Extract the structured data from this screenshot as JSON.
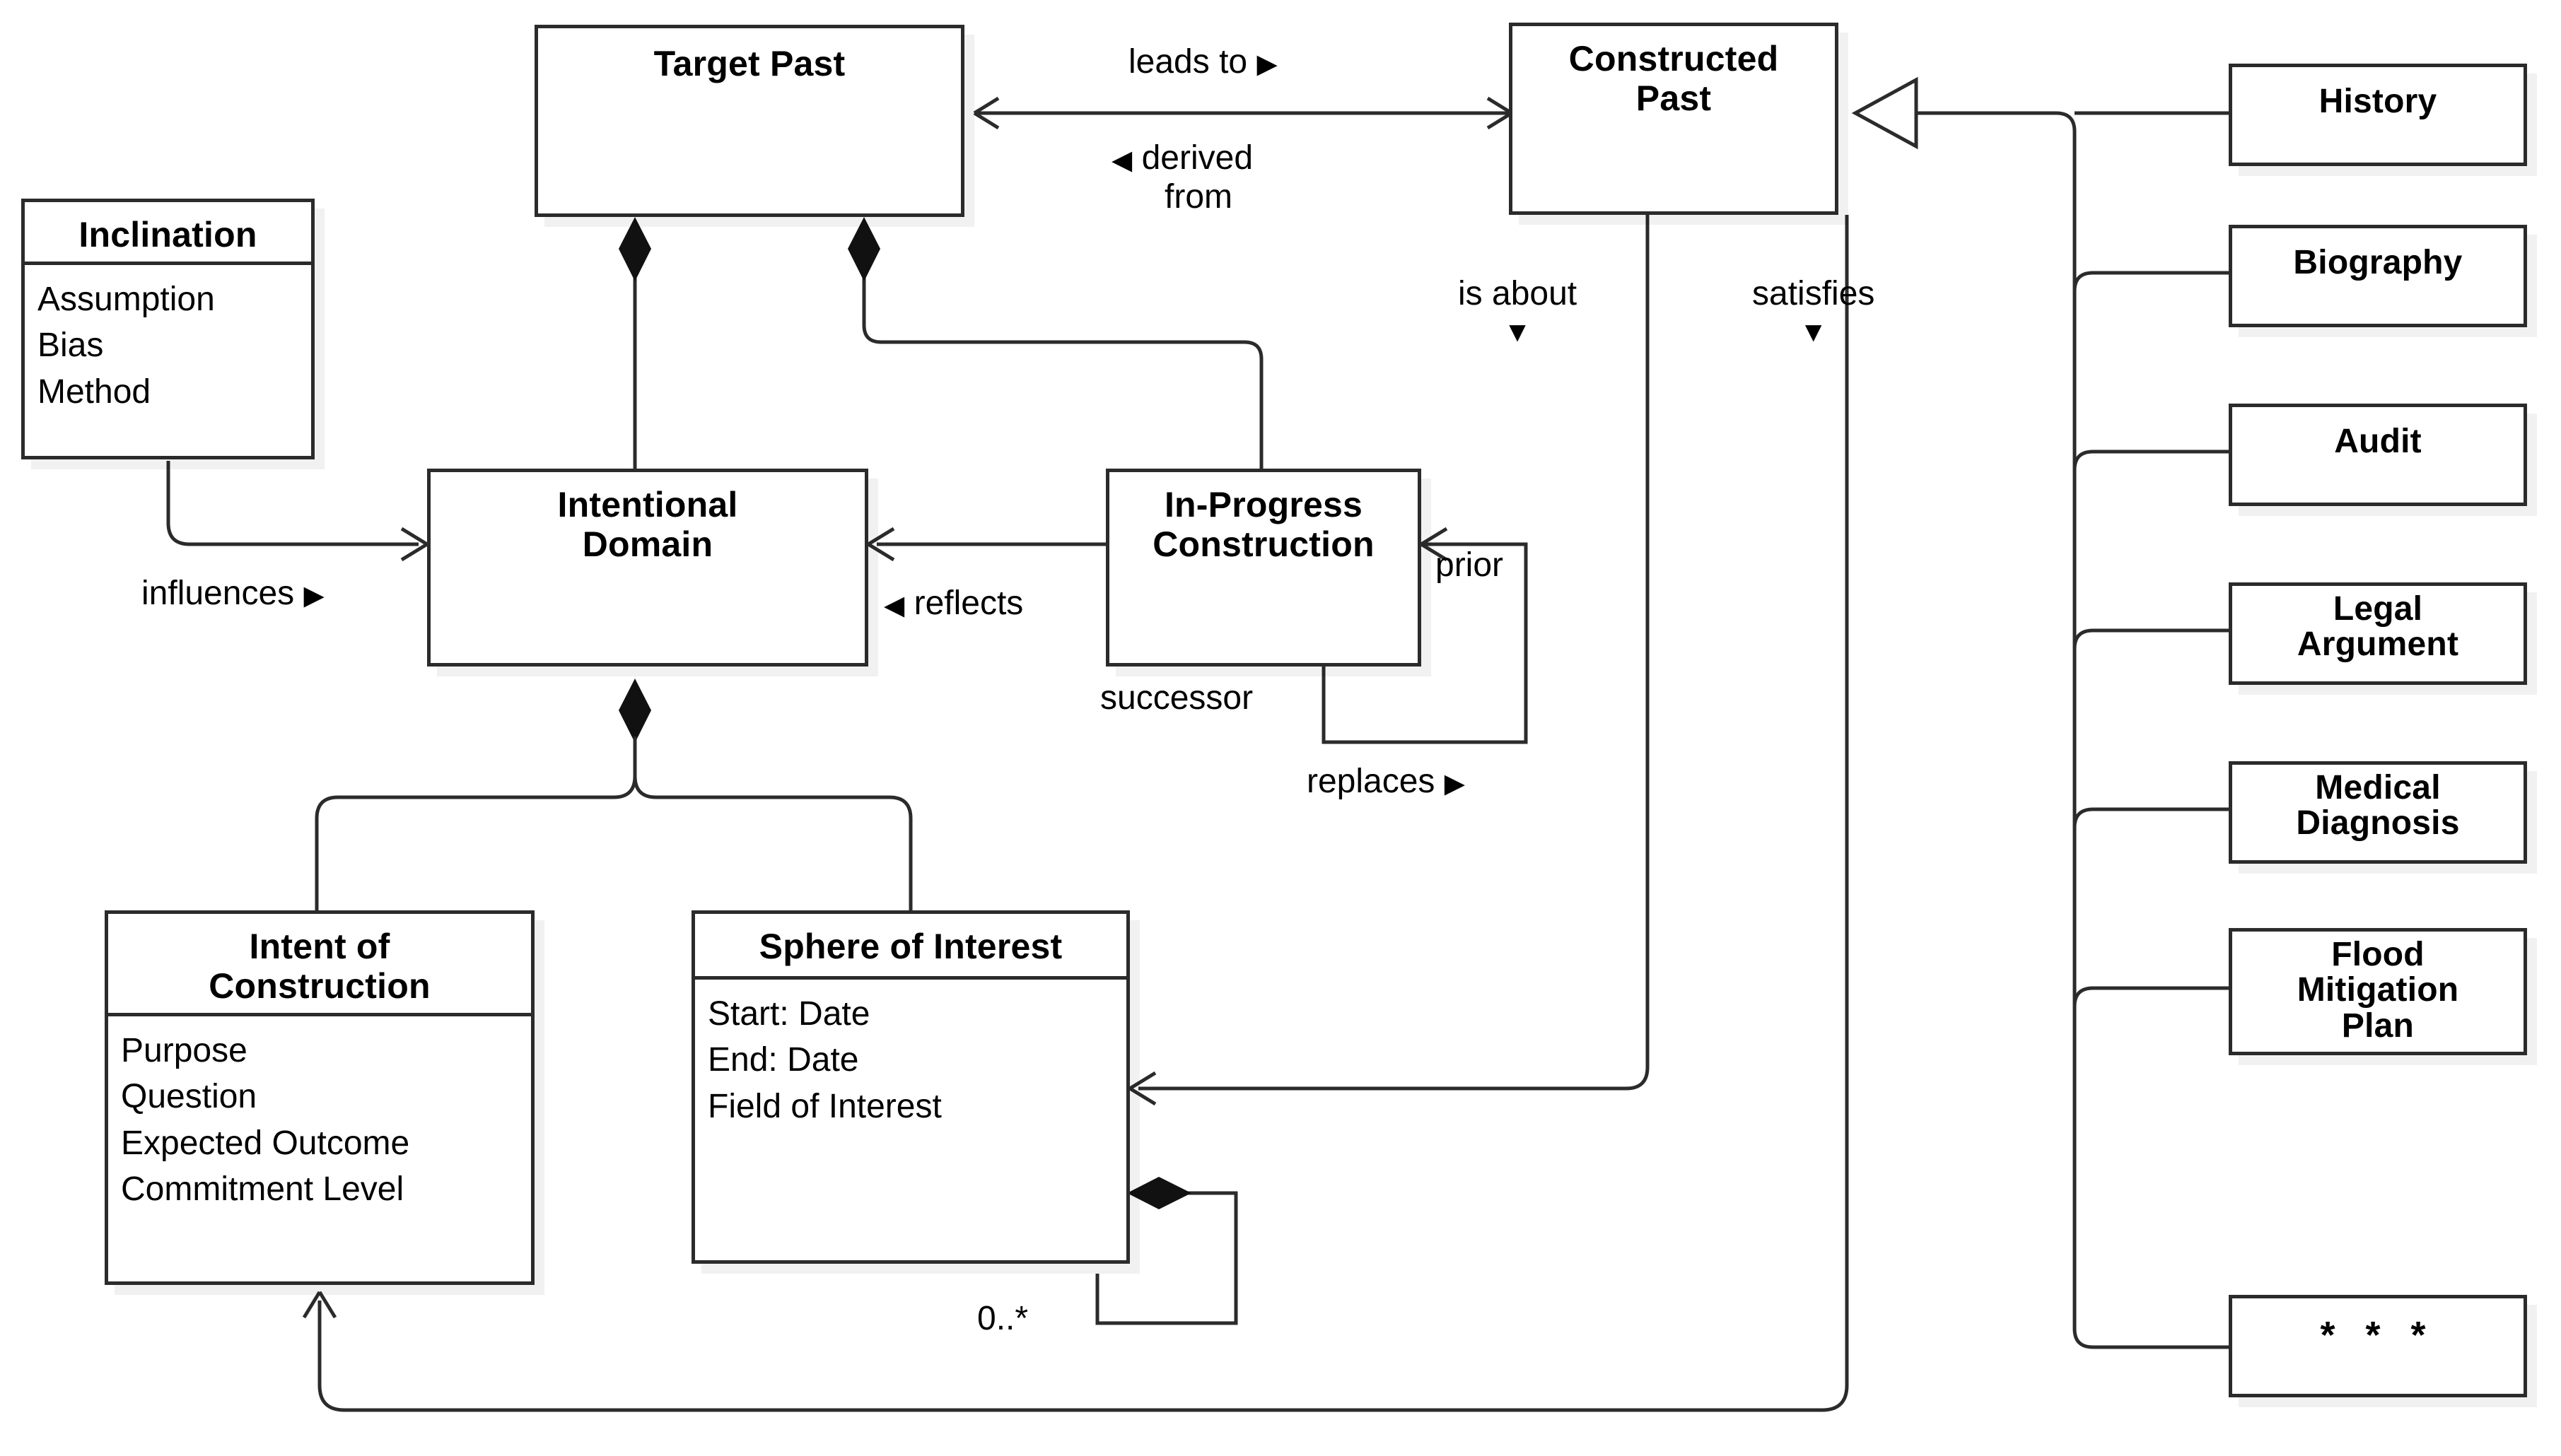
{
  "diagram": {
    "title": "Constructed Past conceptual model",
    "classes": {
      "inclination": {
        "name": "Inclination",
        "attributes": [
          "Assumption",
          "Bias",
          "Method"
        ]
      },
      "target_past": {
        "name": "Target Past"
      },
      "constructed_past": {
        "name": "Constructed\nPast",
        "line1": "Constructed",
        "line2": "Past"
      },
      "intentional_domain": {
        "line1": "Intentional",
        "line2": "Domain"
      },
      "in_progress_construction": {
        "line1": "In-Progress",
        "line2": "Construction"
      },
      "intent_of_construction": {
        "line1": "Intent of",
        "line2": "Construction",
        "attributes": [
          "Purpose",
          "Question",
          "Expected Outcome",
          "Commitment Level"
        ]
      },
      "sphere_of_interest": {
        "name": "Sphere of Interest",
        "attributes": [
          "Start: Date",
          "End: Date",
          "Field of Interest"
        ]
      }
    },
    "subclasses": [
      {
        "id": "history",
        "line1": "History"
      },
      {
        "id": "biography",
        "line1": "Biography"
      },
      {
        "id": "audit",
        "line1": "Audit"
      },
      {
        "id": "legal-argument",
        "line1": "Legal",
        "line2": "Argument"
      },
      {
        "id": "medical-diagnosis",
        "line1": "Medical",
        "line2": "Diagnosis"
      },
      {
        "id": "flood-mitigation",
        "line1": "Flood",
        "line2": "Mitigation",
        "line3": "Plan"
      },
      {
        "id": "ellipsis",
        "line1": "* * *"
      }
    ],
    "edge_labels": {
      "leads_to": "leads to",
      "leads_to_marker": "▶",
      "derived_from_marker": "◀",
      "derived_from_line1": "derived",
      "derived_from_line2": "from",
      "is_about": "is about",
      "is_about_marker": "▼",
      "satisfies": "satisfies",
      "satisfies_marker": "▼",
      "influences": "influences",
      "influences_marker": "▶",
      "reflects_marker": "◀",
      "reflects": "reflects",
      "prior": "prior",
      "successor": "successor",
      "replaces": "replaces",
      "replaces_marker": "▶",
      "multiplicity_zero_to_many": "0..*"
    },
    "colors": {
      "line": "#2b2b2b",
      "text": "#000000",
      "background": "#ffffff",
      "shadow": "rgba(0,0,0,0.055)"
    }
  }
}
